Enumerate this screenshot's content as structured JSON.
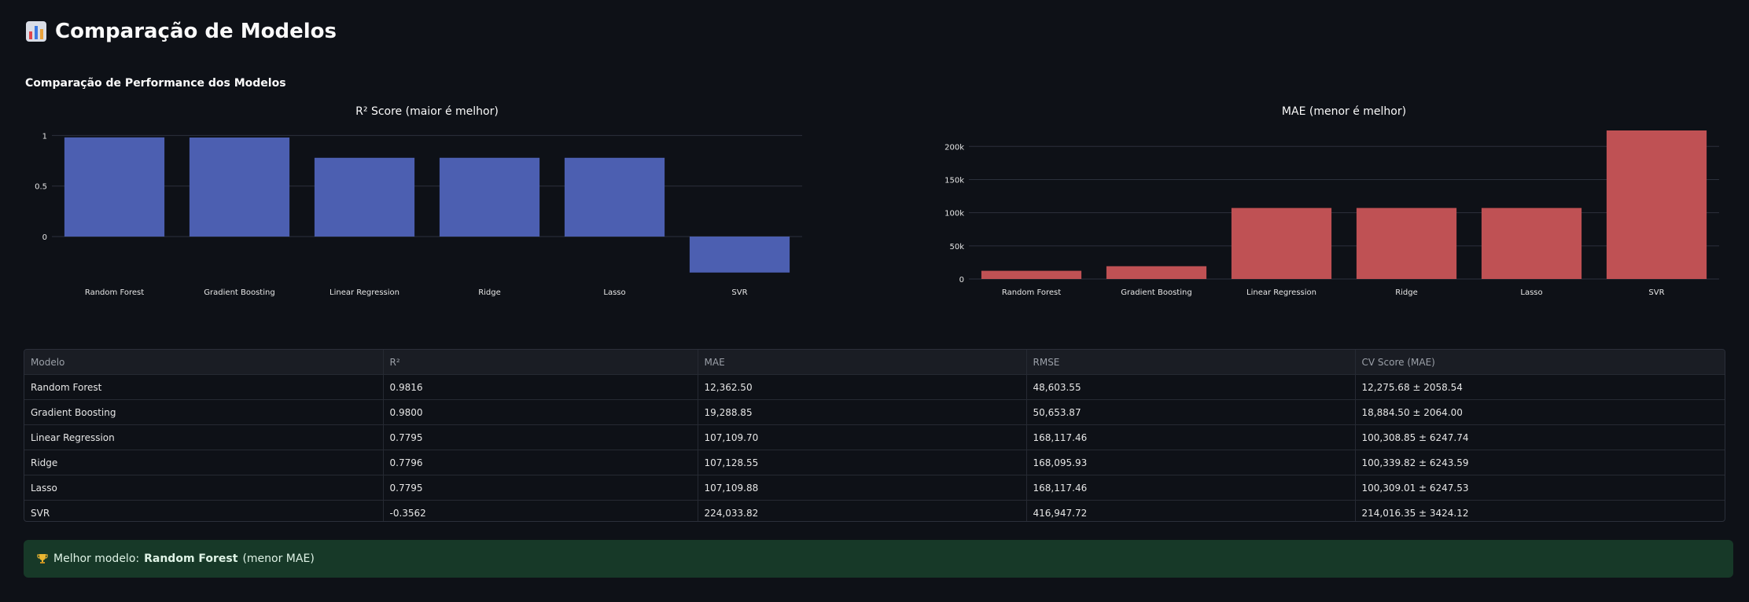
{
  "page": {
    "title": "Comparação de Modelos",
    "title_icon": "bar-chart-icon",
    "subtitle": "Comparação de Performance dos Modelos"
  },
  "chart_data": [
    {
      "type": "bar",
      "title": "R² Score (maior é melhor)",
      "categories": [
        "Random Forest",
        "Gradient Boosting",
        "Linear Regression",
        "Ridge",
        "Lasso",
        "SVR"
      ],
      "values": [
        0.9816,
        0.98,
        0.7795,
        0.7796,
        0.7795,
        -0.3562
      ],
      "yticks": [
        0,
        0.5,
        1
      ],
      "ytick_labels": [
        "0",
        "0.5",
        "1"
      ],
      "ylim": [
        -0.42,
        1.05
      ],
      "color": "#4c5fb1",
      "grid": true
    },
    {
      "type": "bar",
      "title": "MAE (menor é melhor)",
      "categories": [
        "Random Forest",
        "Gradient Boosting",
        "Linear Regression",
        "Ridge",
        "Lasso",
        "SVR"
      ],
      "values": [
        12362.5,
        19288.85,
        107109.7,
        107128.55,
        107109.88,
        224033.82
      ],
      "yticks": [
        0,
        50000,
        100000,
        150000,
        200000
      ],
      "ytick_labels": [
        "0",
        "50k",
        "100k",
        "150k",
        "200k"
      ],
      "ylim": [
        0,
        224033.82
      ],
      "color": "#bf5154",
      "grid": true
    }
  ],
  "table": {
    "headers": [
      "Modelo",
      "R²",
      "MAE",
      "RMSE",
      "CV Score (MAE)"
    ],
    "rows": [
      [
        "Random Forest",
        "0.9816",
        "12,362.50",
        "48,603.55",
        "12,275.68 ± 2058.54"
      ],
      [
        "Gradient Boosting",
        "0.9800",
        "19,288.85",
        "50,653.87",
        "18,884.50 ± 2064.00"
      ],
      [
        "Linear Regression",
        "0.7795",
        "107,109.70",
        "168,117.46",
        "100,308.85 ± 6247.74"
      ],
      [
        "Ridge",
        "0.7796",
        "107,128.55",
        "168,095.93",
        "100,339.82 ± 6243.59"
      ],
      [
        "Lasso",
        "0.7795",
        "107,109.88",
        "168,117.46",
        "100,309.01 ± 6247.53"
      ],
      [
        "SVR",
        "-0.3562",
        "224,033.82",
        "416,947.72",
        "214,016.35 ± 3424.12"
      ]
    ]
  },
  "result": {
    "icon": "trophy-icon",
    "prefix": "Melhor modelo:",
    "model": "Random Forest",
    "suffix": "(menor MAE)"
  }
}
